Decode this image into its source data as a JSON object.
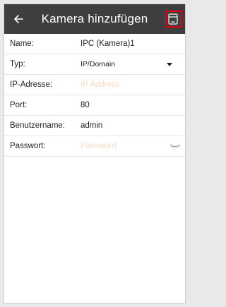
{
  "header": {
    "title": "Kamera hinzufügen",
    "back_icon": "arrow-left-icon",
    "save_icon": "save-icon",
    "save_highlight_color": "#e2000f",
    "background_color": "#3e3e3e"
  },
  "form": {
    "name": {
      "label": "Name:",
      "value": "IPC (Kamera)1"
    },
    "type": {
      "label": "Typ:",
      "value": "IP/Domain",
      "icon": "dropdown-arrow-icon"
    },
    "ip": {
      "label": "IP-Adresse:",
      "placeholder": "IP Address"
    },
    "port": {
      "label": "Port:",
      "value": "80"
    },
    "username": {
      "label": "Benutzername:",
      "value": "admin"
    },
    "password": {
      "label": "Passwort:",
      "placeholder": "Password",
      "icon": "password-visibility-icon"
    }
  }
}
